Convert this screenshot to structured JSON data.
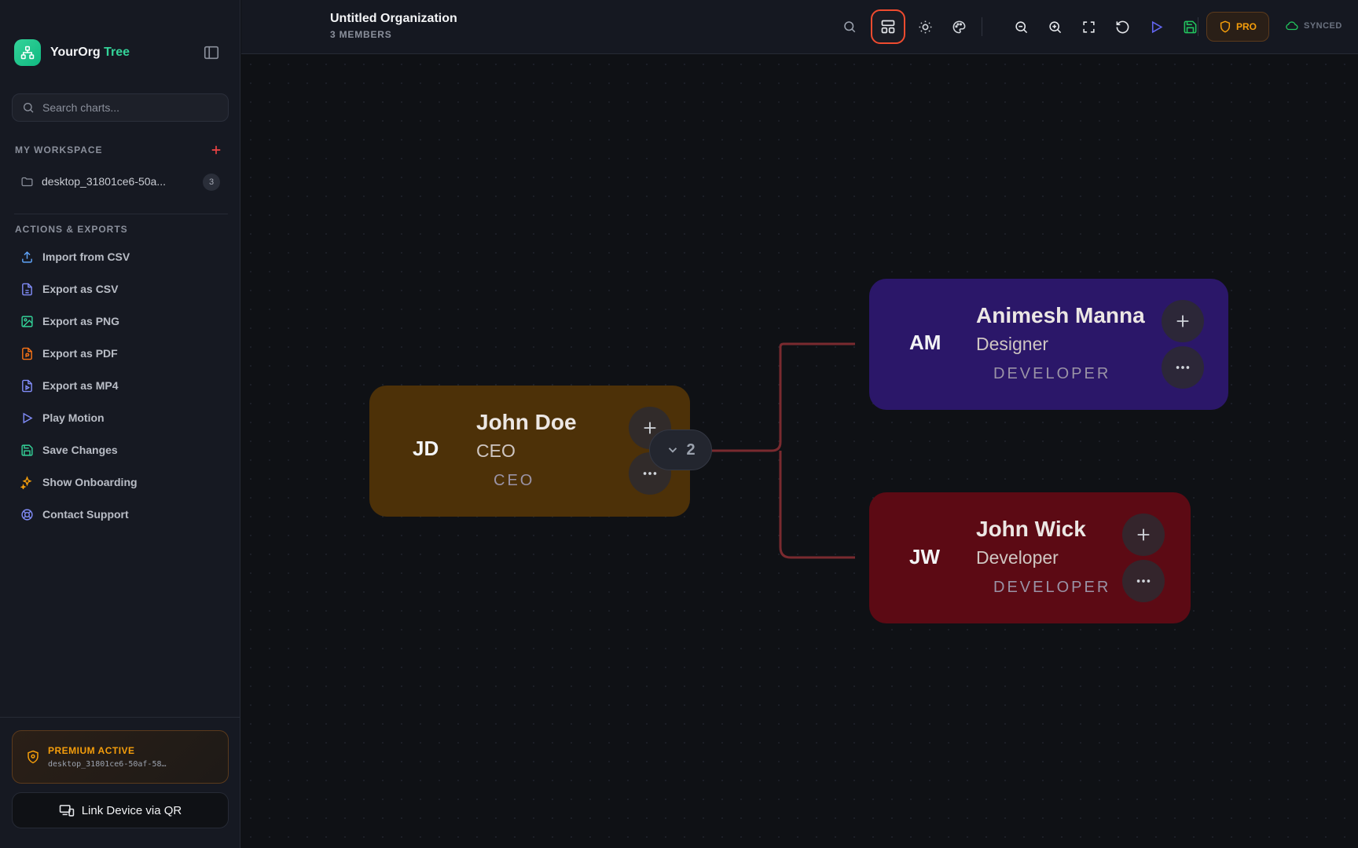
{
  "sidebar": {
    "brand": {
      "name": "YourOrg",
      "accent": "Tree"
    },
    "search": {
      "placeholder": "Search charts..."
    },
    "workspace": {
      "title": "MY WORKSPACE",
      "items": [
        {
          "label": "desktop_31801ce6-50a...",
          "count": "3"
        }
      ]
    },
    "actions": {
      "title": "ACTIONS & EXPORTS",
      "items": [
        {
          "label": "Import from CSV",
          "icon": "upload-icon"
        },
        {
          "label": "Export as CSV",
          "icon": "csv-file-icon"
        },
        {
          "label": "Export as PNG",
          "icon": "image-file-icon"
        },
        {
          "label": "Export as PDF",
          "icon": "pdf-file-icon"
        },
        {
          "label": "Export as MP4",
          "icon": "video-file-icon"
        },
        {
          "label": "Play Motion",
          "icon": "play-icon"
        },
        {
          "label": "Save Changes",
          "icon": "save-icon"
        },
        {
          "label": "Show Onboarding",
          "icon": "sparkles-icon"
        },
        {
          "label": "Contact Support",
          "icon": "lifebuoy-icon"
        }
      ]
    },
    "premium": {
      "title": "PREMIUM ACTIVE",
      "subtitle": "desktop_31801ce6-50af-58…"
    },
    "link_device": {
      "label": "Link Device via QR"
    }
  },
  "header": {
    "title": "Untitled Organization",
    "subtitle": "3 MEMBERS",
    "pro_label": "PRO",
    "sync_label": "SYNCED"
  },
  "chart": {
    "nodes": [
      {
        "initials": "JD",
        "name": "John Doe",
        "role": "CEO",
        "department": "CEO",
        "color": "#4d3108"
      },
      {
        "initials": "AM",
        "name": "Animesh Manna",
        "role": "Designer",
        "department": "DEVELOPER",
        "color": "#2b1769"
      },
      {
        "initials": "JW",
        "name": "John Wick",
        "role": "Developer",
        "department": "DEVELOPER",
        "color": "#5c0a14"
      }
    ],
    "collapse_count": "2"
  },
  "colors": {
    "accent_green": "#34d399",
    "accent_orange": "#f59e0b",
    "active_outline": "#ef4b2f",
    "connector": "#7a2a2f"
  }
}
